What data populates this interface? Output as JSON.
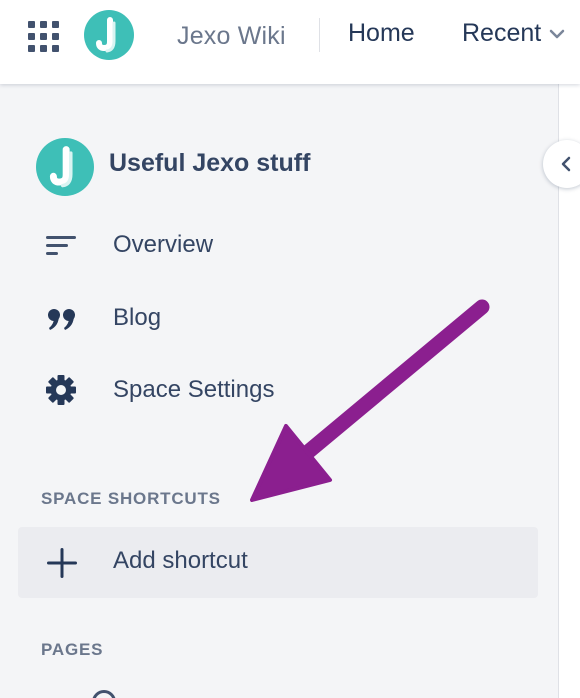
{
  "header": {
    "app_title": "Jexo Wiki",
    "nav": {
      "home": "Home",
      "recent": "Recent"
    },
    "icons": {
      "apps": "apps-grid-icon",
      "logo": "jexo-logo-icon",
      "recent_chevron": "chevron-down-icon"
    }
  },
  "sidebar": {
    "space_name": "Useful Jexo stuff",
    "items": [
      {
        "label": "Overview",
        "icon": "overview-lines-icon"
      },
      {
        "label": "Blog",
        "icon": "quote-icon"
      },
      {
        "label": "Space Settings",
        "icon": "gear-icon"
      }
    ],
    "shortcuts_header": "SPACE SHORTCUTS",
    "add_shortcut_label": "Add shortcut",
    "pages_header": "PAGES",
    "collapse_icon": "chevron-left-icon"
  },
  "annotation": {
    "arrow_color": "#8b1f8f"
  },
  "colors": {
    "brand_teal": "#3ebfb7",
    "text_dark": "#344563",
    "muted": "#6b778c"
  }
}
